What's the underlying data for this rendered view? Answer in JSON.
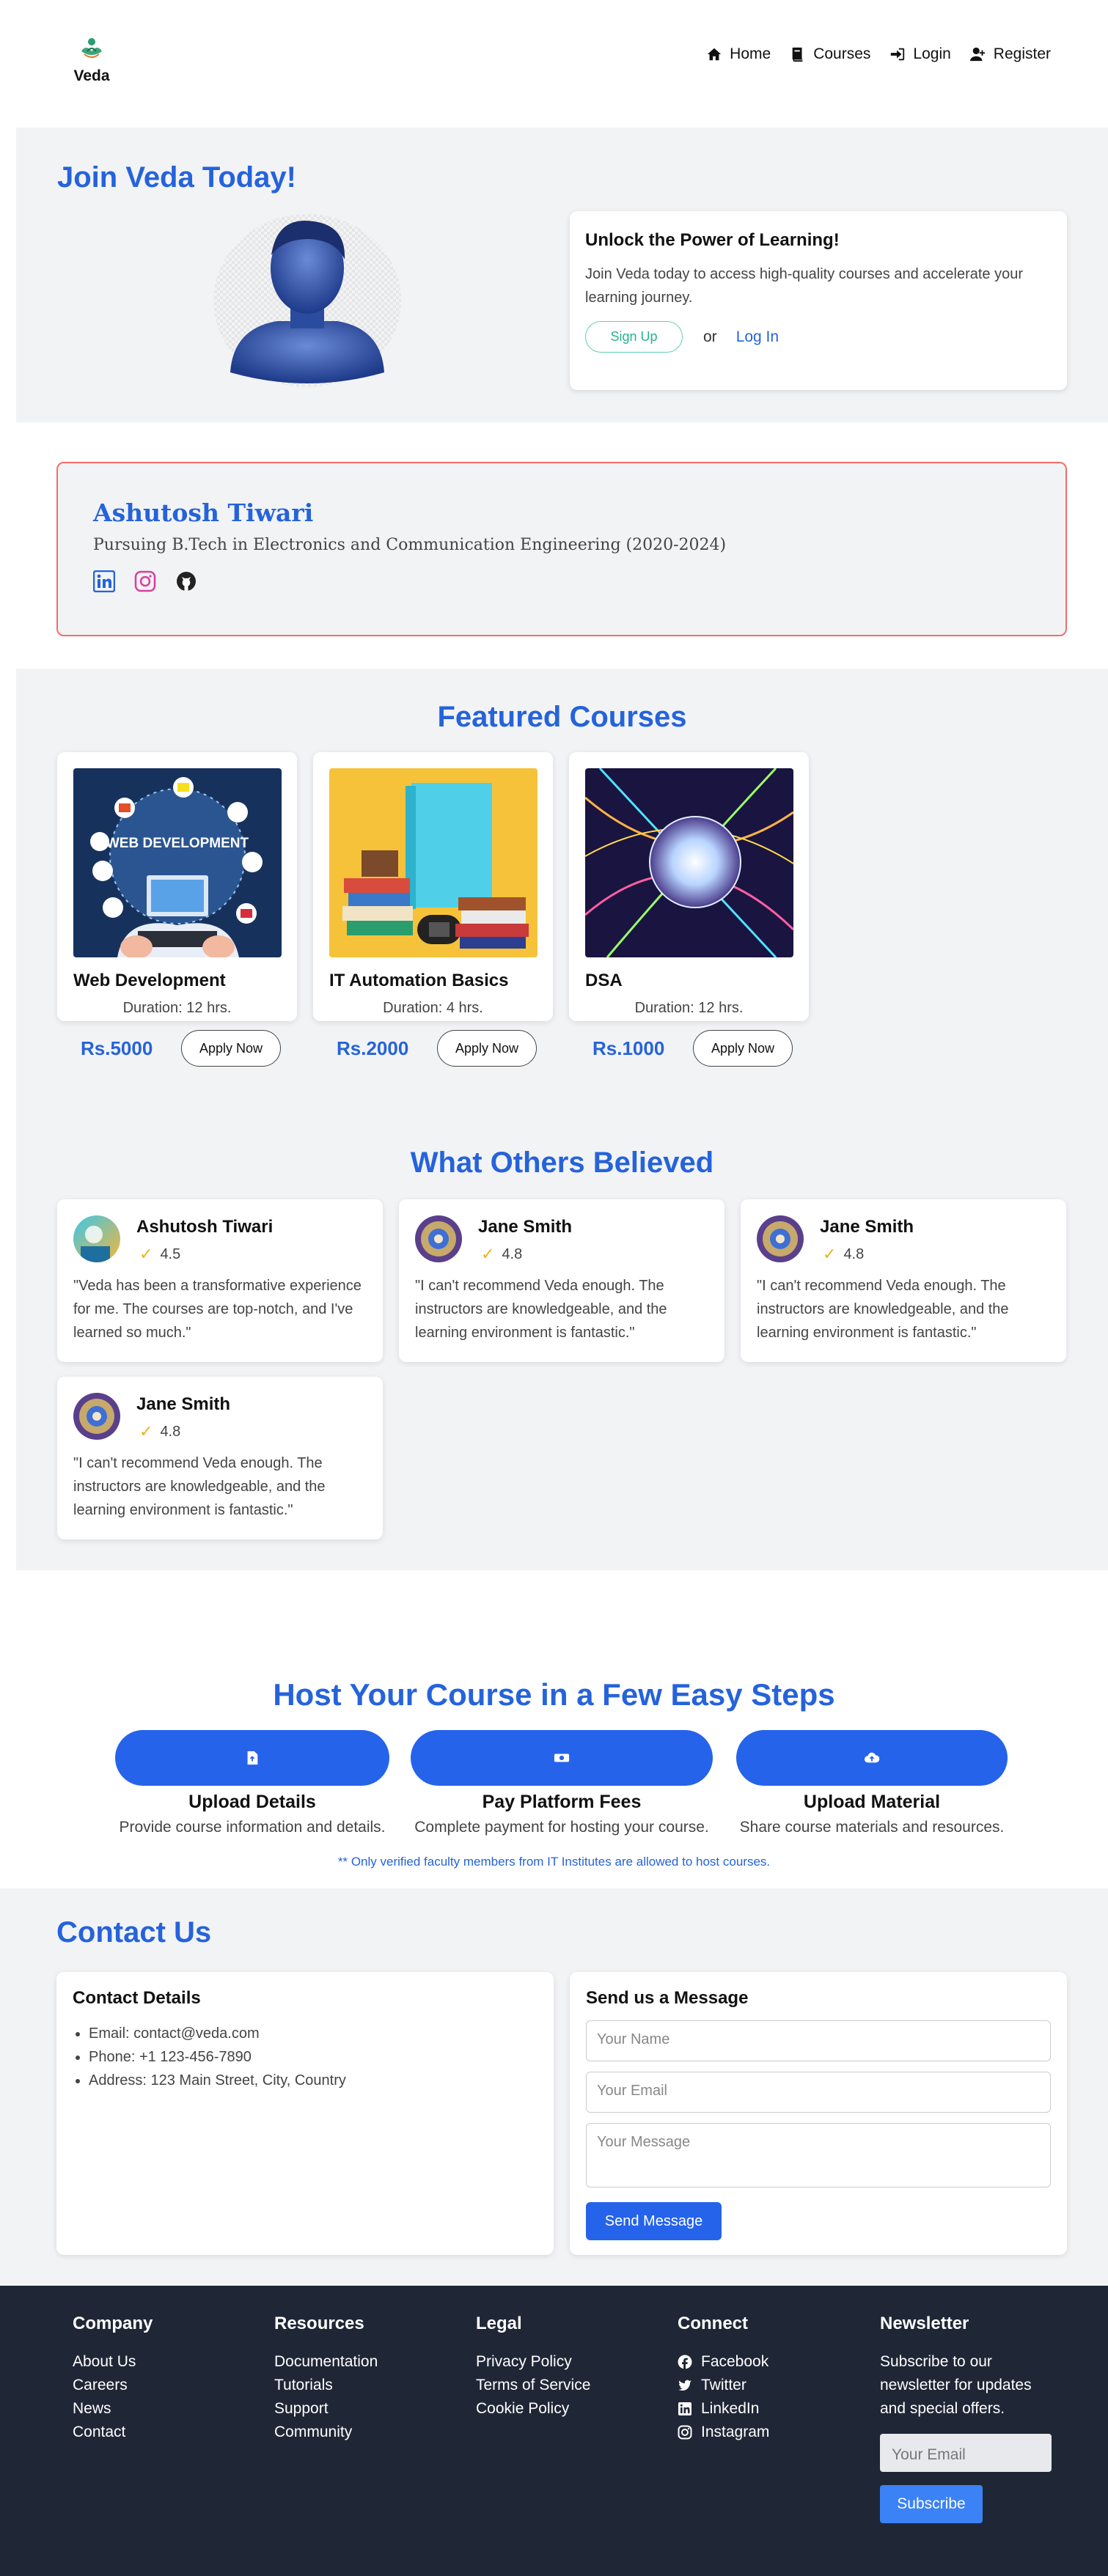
{
  "nav": {
    "brand": "Veda",
    "links": [
      {
        "label": "Home",
        "icon": "home-icon"
      },
      {
        "label": "Courses",
        "icon": "book-icon"
      },
      {
        "label": "Login",
        "icon": "sign-in-icon"
      },
      {
        "label": "Register",
        "icon": "user-plus-icon"
      }
    ]
  },
  "join": {
    "title": "Join Veda Today!",
    "card_title": "Unlock the Power of Learning!",
    "card_text": "Join Veda today to access high-quality courses and accelerate your learning journey.",
    "signup": "Sign Up",
    "or": "or",
    "login": "Log In"
  },
  "profile": {
    "name": "Ashutosh Tiwari",
    "subtitle": "Pursuing B.Tech in Electronics and Communication Engineering (2020-2024)"
  },
  "featured": {
    "title": "Featured Courses",
    "courses": [
      {
        "name": "Web Development",
        "duration": "Duration: 12 hrs.",
        "price": "Rs.5000",
        "apply": "Apply Now",
        "img_text": "WEB DEVELOPMENT"
      },
      {
        "name": "IT Automation Basics",
        "duration": "Duration: 4 hrs.",
        "price": "Rs.2000",
        "apply": "Apply Now"
      },
      {
        "name": "DSA",
        "duration": "Duration: 12 hrs.",
        "price": "Rs.1000",
        "apply": "Apply Now"
      }
    ]
  },
  "reviews": {
    "title": "What Others Believed",
    "items": [
      {
        "name": "Ashutosh Tiwari",
        "rating": "4.5",
        "text": "\"Veda has been a transformative experience for me. The courses are top-notch, and I've learned so much.\""
      },
      {
        "name": "Jane Smith",
        "rating": "4.8",
        "text": "\"I can't recommend Veda enough. The instructors are knowledgeable, and the learning environment is fantastic.\""
      },
      {
        "name": "Jane Smith",
        "rating": "4.8",
        "text": "\"I can't recommend Veda enough. The instructors are knowledgeable, and the learning environment is fantastic.\""
      },
      {
        "name": "Jane Smith",
        "rating": "4.8",
        "text": "\"I can't recommend Veda enough. The instructors are knowledgeable, and the learning environment is fantastic.\""
      }
    ]
  },
  "host": {
    "title": "Host Your Course in a Few Easy Steps",
    "steps": [
      {
        "title": "Upload Details",
        "desc": "Provide course information and details.",
        "icon": "file-upload-icon"
      },
      {
        "title": "Pay Platform Fees",
        "desc": "Complete payment for hosting your course.",
        "icon": "money-icon"
      },
      {
        "title": "Upload Material",
        "desc": "Share course materials and resources.",
        "icon": "cloud-upload-icon"
      }
    ],
    "note": "** Only verified faculty members from IT Institutes are allowed to host courses."
  },
  "contact": {
    "title": "Contact Us",
    "details_title": "Contact Details",
    "email": "Email: contact@veda.com",
    "phone": "Phone: +1 123-456-7890",
    "address": "Address: 123 Main Street, City, Country",
    "form_title": "Send us a Message",
    "name_ph": "Your Name",
    "email_ph": "Your Email",
    "message_ph": "Your Message",
    "send": "Send Message"
  },
  "footer": {
    "company": {
      "title": "Company",
      "links": [
        "About Us",
        "Careers",
        "News",
        "Contact"
      ]
    },
    "resources": {
      "title": "Resources",
      "links": [
        "Documentation",
        "Tutorials",
        "Support",
        "Community"
      ]
    },
    "legal": {
      "title": "Legal",
      "links": [
        "Privacy Policy",
        "Terms of Service",
        "Cookie Policy"
      ]
    },
    "connect": {
      "title": "Connect",
      "links": [
        "Facebook",
        "Twitter",
        "LinkedIn",
        "Instagram"
      ]
    },
    "newsletter": {
      "title": "Newsletter",
      "text": "Subscribe to our newsletter for updates and special offers.",
      "placeholder": "Your Email",
      "button": "Subscribe"
    }
  },
  "colors": {
    "accent": "#2563db",
    "button": "#2563eb",
    "footer": "#1f2736",
    "profile_border": "#f26d6d",
    "signup": "#26b393"
  }
}
